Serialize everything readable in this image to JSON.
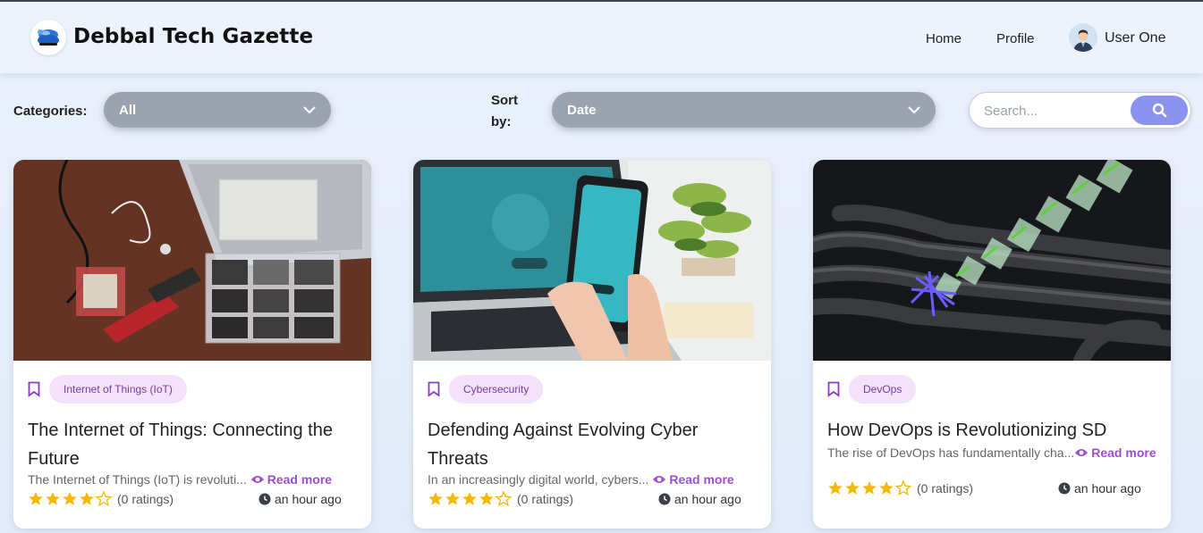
{
  "header": {
    "brand": "Debbal Tech Gazette",
    "nav": {
      "home": "Home",
      "profile": "Profile"
    },
    "user": "User One"
  },
  "filters": {
    "categories_label": "Categories:",
    "categories_value": "All",
    "sort_label": "Sort by:",
    "sort_value": "Date",
    "search_placeholder": "Search..."
  },
  "colors": {
    "accent": "#8b93ee",
    "tag_bg": "#f3e2fa",
    "tag_text": "#7a3aa6",
    "star": "#f5b800"
  },
  "articles": [
    {
      "category": "Internet of Things (IoT)",
      "title": "The Internet of Things: Connecting the Future",
      "excerpt": "The Internet of Things (IoT) is revoluti...",
      "read_more": "Read more",
      "rating": 4,
      "ratings_text": "(0 ratings)",
      "time": "an hour ago"
    },
    {
      "category": "Cybersecurity",
      "title": "Defending Against Evolving Cyber Threats",
      "excerpt": "In an increasingly digital world, cybers...",
      "read_more": "Read more",
      "rating": 4,
      "ratings_text": "(0 ratings)",
      "time": "an hour ago"
    },
    {
      "category": "DevOps",
      "title": "How DevOps is Revolutionizing SD",
      "excerpt": "The rise of DevOps has fundamentally cha...",
      "read_more": "Read more",
      "rating": 4,
      "ratings_text": "(0 ratings)",
      "time": "an hour ago"
    }
  ]
}
